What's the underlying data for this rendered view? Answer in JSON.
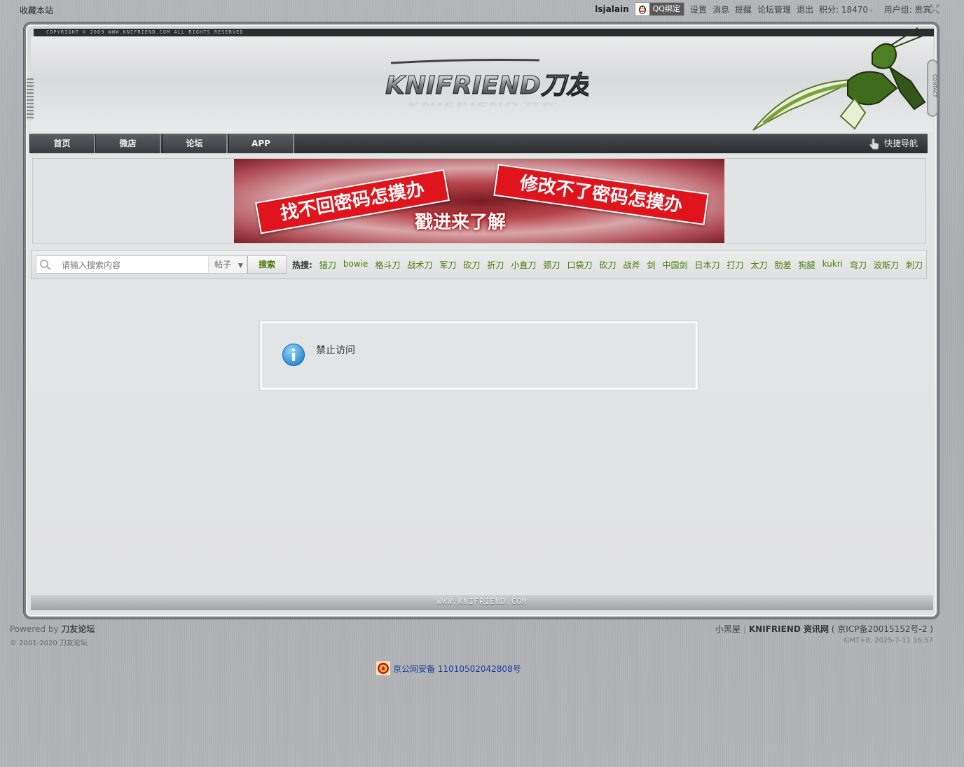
{
  "topbar": {
    "favorite": "收藏本站",
    "username": "lsjalain",
    "qq_bind": "QQ绑定",
    "links": [
      "设置",
      "消息",
      "提醒",
      "论坛管理",
      "退出"
    ],
    "points": "积分: 18470",
    "usergroup": "用户组: 贵宾"
  },
  "header": {
    "copyright_strip": "COPYRIGHT © 2009 WWW.KNIFRIEND.COM ALL RIGHTS RESERVED",
    "logo_text": "KNIFRIEND刀友",
    "side_tab": "CONTACT"
  },
  "nav": {
    "items": [
      "首页",
      "微店",
      "论坛",
      "APP"
    ],
    "quick_nav": "快捷导航"
  },
  "banner": {
    "line1": "找不回密码怎摸办",
    "line2": "修改不了密码怎摸办",
    "line3": "戳进来了解"
  },
  "search": {
    "placeholder": "请输入搜索内容",
    "type": "帖子",
    "button": "搜索",
    "hot_label": "热搜:",
    "hot_items": [
      "猎刀",
      "bowie",
      "格斗刀",
      "战术刀",
      "军刀",
      "砍刀",
      "折刀",
      "小直刀",
      "颈刀",
      "口袋刀",
      "砍刀",
      "战斧",
      "剑",
      "中国剑",
      "日本刀",
      "打刀",
      "太刀",
      "肋差",
      "狗腿",
      "kukri",
      "弯刀",
      "波斯刀",
      "刺刀"
    ]
  },
  "message": {
    "text": "禁止访问"
  },
  "frame_footer": {
    "url": "WWW.KNIFRIEND.COM"
  },
  "footer": {
    "powered_prefix": "Powered by",
    "powered_name": "刀友论坛",
    "copyright": "© 2001-2020 刀友论坛",
    "link1": "小黑屋",
    "link2": "KNIFRIEND 资讯网",
    "icp": "( 京ICP备20015152号-2 )",
    "time": "GMT+8, 2025-7-11 16:57",
    "police": "京公网安备 11010502042808号"
  },
  "colors": {
    "hot_link": "#4a7a05",
    "nav_bg": "#2c2d30",
    "banner_red": "#e0141c"
  }
}
